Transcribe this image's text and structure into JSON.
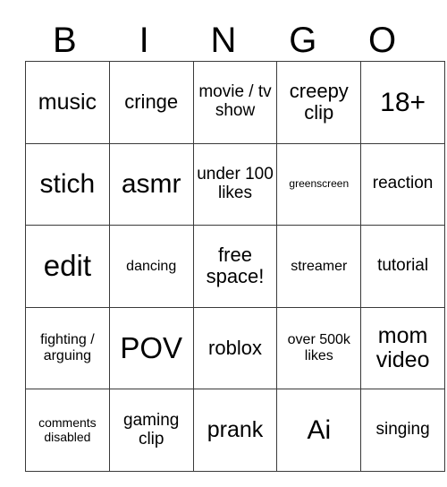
{
  "card": {
    "header_letters": [
      "B",
      "I",
      "N",
      "G",
      "O"
    ],
    "rows": [
      [
        {
          "text": "music",
          "size": "xl"
        },
        {
          "text": "cringe",
          "size": "l"
        },
        {
          "text": "movie / tv show",
          "size": "ml"
        },
        {
          "text": "creepy clip",
          "size": "l"
        },
        {
          "text": "18+",
          "size": "xxl"
        }
      ],
      [
        {
          "text": "stich",
          "size": "xxl"
        },
        {
          "text": "asmr",
          "size": "xxl"
        },
        {
          "text": "under 100 likes",
          "size": "ml"
        },
        {
          "text": "greenscreen",
          "size": "xs"
        },
        {
          "text": "reaction",
          "size": "ml"
        }
      ],
      [
        {
          "text": "edit",
          "size": "mega"
        },
        {
          "text": "dancing",
          "size": "m"
        },
        {
          "text": "free space!",
          "size": "l"
        },
        {
          "text": "streamer",
          "size": "m"
        },
        {
          "text": "tutorial",
          "size": "ml"
        }
      ],
      [
        {
          "text": "fighting / arguing",
          "size": "m"
        },
        {
          "text": "POV",
          "size": "mega"
        },
        {
          "text": "roblox",
          "size": "l"
        },
        {
          "text": "over 500k likes",
          "size": "m"
        },
        {
          "text": "mom video",
          "size": "xl"
        }
      ],
      [
        {
          "text": "comments disabled",
          "size": "s"
        },
        {
          "text": "gaming clip",
          "size": "ml"
        },
        {
          "text": "prank",
          "size": "xl"
        },
        {
          "text": "Ai",
          "size": "xxl"
        },
        {
          "text": "singing",
          "size": "ml"
        }
      ]
    ],
    "free_space_index": {
      "row": 2,
      "col": 2
    },
    "colors": {
      "background": "#ffffff",
      "border": "#3a3a3a",
      "text": "#000000"
    }
  }
}
